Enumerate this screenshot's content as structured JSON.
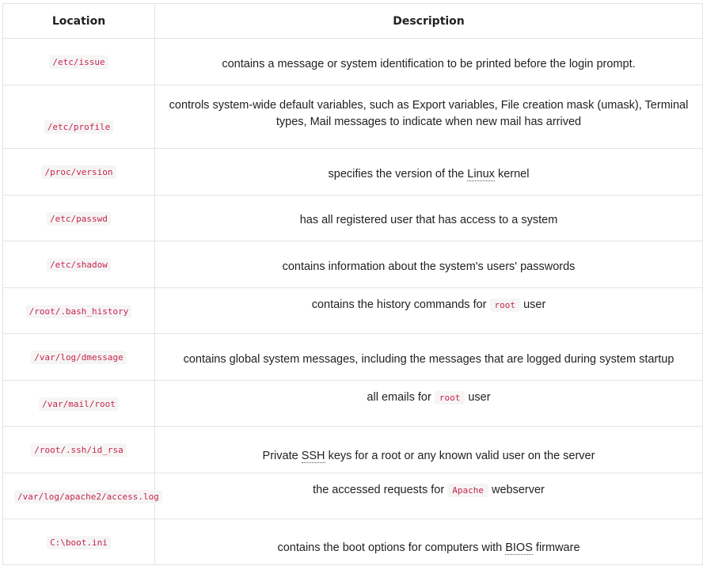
{
  "table": {
    "headers": {
      "location": "Location",
      "description": "Description"
    },
    "rows": [
      {
        "location": "/etc/issue",
        "description": "contains a message or system identification to be printed before the login prompt."
      },
      {
        "location": "/etc/profile",
        "description": "controls system-wide default variables, such as Export variables, File creation mask (umask), Terminal types, Mail messages to indicate when new mail has arrived"
      },
      {
        "location": "/proc/version",
        "description_before": "specifies the version of the",
        "description_term": "Linux",
        "description_after": "kernel"
      },
      {
        "location": "/etc/passwd",
        "description": "has all registered user that has access to a system"
      },
      {
        "location": "/etc/shadow",
        "description": "contains information about the system's users' passwords"
      },
      {
        "location": "/root/.bash_history",
        "description_before": "contains the history commands for",
        "description_code": "root",
        "description_after": "user"
      },
      {
        "location": "/var/log/dmessage",
        "description": "contains global system messages, including the messages that are logged during system startup"
      },
      {
        "location": "/var/mail/root",
        "description_before": "all emails for",
        "description_code": "root",
        "description_after": "user"
      },
      {
        "location": "/root/.ssh/id_rsa",
        "description_before": "Private",
        "description_term": "SSH",
        "description_after": "keys for a root or any known valid user on the server"
      },
      {
        "location": "/var/log/apache2/access.log",
        "description_before": "the accessed requests for",
        "description_code": "Apache",
        "description_after": "webserver"
      },
      {
        "location": "C:\\boot.ini",
        "description_before": "contains the boot options for computers with",
        "description_term": "BIOS",
        "description_after": "firmware"
      }
    ]
  }
}
